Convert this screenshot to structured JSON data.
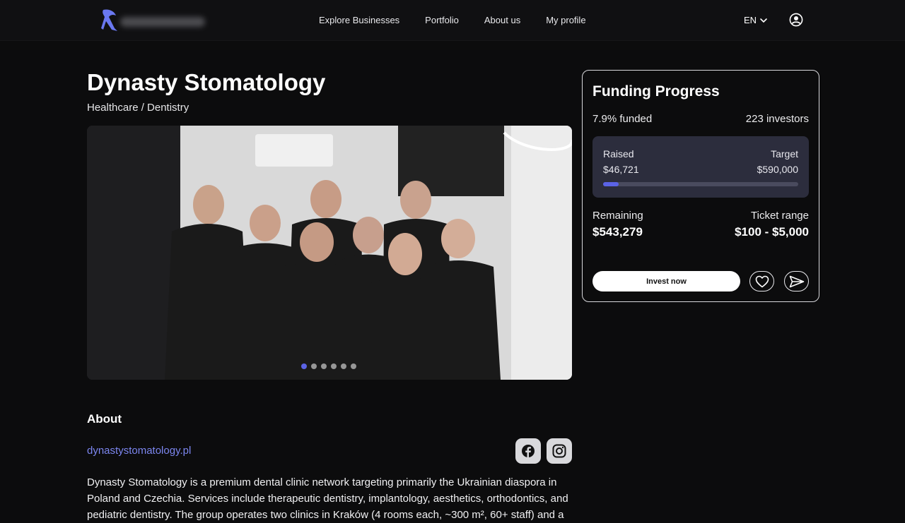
{
  "nav": {
    "items": [
      {
        "label": "Explore Businesses"
      },
      {
        "label": "Portfolio"
      },
      {
        "label": "About us"
      },
      {
        "label": "My profile"
      }
    ],
    "language": "EN",
    "icons": {
      "logo": "kangaroo-logo-icon",
      "language_chevron": "chevron-down-icon",
      "profile": "user-circle-icon"
    }
  },
  "business": {
    "name": "Dynasty Stomatology",
    "category": "Healthcare / Dentistry"
  },
  "gallery": {
    "slide_count": 6,
    "active_index": 0
  },
  "about": {
    "heading": "About",
    "website": "dynastystomatology.pl",
    "social": [
      "facebook-icon",
      "instagram-icon"
    ],
    "text": "Dynasty Stomatology is a premium dental clinic network targeting primarily the Ukrainian diaspora in Poland and Czechia. Services include therapeutic dentistry, implantology, aesthetics, orthodontics, and pediatric dentistry. The group operates two clinics in Kraków (4 rooms each, ~300 m², 60+ staff) and a"
  },
  "funding": {
    "title": "Funding Progress",
    "funded": "7.9% funded",
    "investors": "223 investors",
    "raised_label": "Raised",
    "raised_value": "$46,721",
    "target_label": "Target",
    "target_value": "$590,000",
    "progress_fraction": 0.079,
    "remaining_label": "Remaining",
    "remaining_value": "$543,279",
    "ticket_label": "Ticket range",
    "ticket_value": "$100 - $5,000",
    "invest_label": "Invest now",
    "accent_color": "#5b63e6"
  }
}
